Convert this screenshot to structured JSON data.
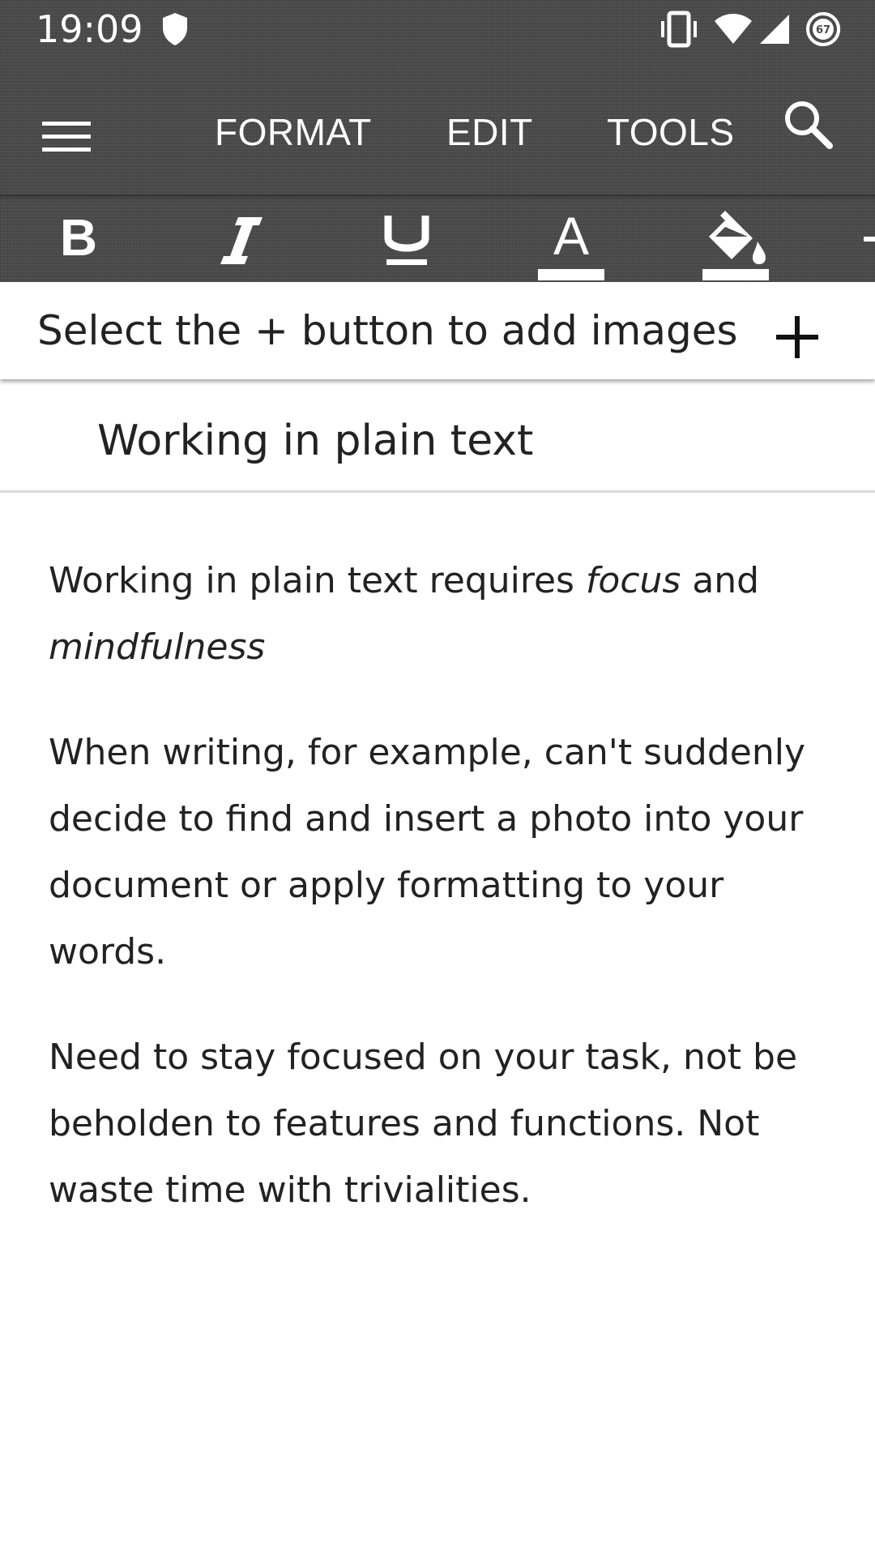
{
  "status_bar": {
    "time": "19:09",
    "icons": [
      "shield-icon",
      "vibrate-icon",
      "wifi-icon",
      "cell-signal-icon",
      "battery-icon"
    ],
    "battery_level": "67"
  },
  "app_bar": {
    "menu_icon": "hamburger-menu-icon",
    "tabs": [
      {
        "label": "FORMAT"
      },
      {
        "label": "EDIT"
      },
      {
        "label": "TOOLS"
      }
    ],
    "search_icon": "search-icon"
  },
  "format_toolbar": {
    "buttons": [
      {
        "name": "bold",
        "glyph": "B"
      },
      {
        "name": "italic",
        "glyph": "I"
      },
      {
        "name": "underline",
        "glyph": "U"
      },
      {
        "name": "text-color",
        "glyph": "A"
      },
      {
        "name": "fill-color",
        "glyph": ""
      }
    ]
  },
  "image_hint": {
    "text": "Select the + button to add images",
    "add_icon": "plus-icon"
  },
  "document": {
    "title": "Working in plain text",
    "paragraphs": [
      {
        "part1": "Working in plain text requires ",
        "italic1": "focus",
        "part2": " and ",
        "italic2": "mindfulness"
      },
      {
        "text": "When writing, for example, can't suddenly decide to find and insert a photo into your document or apply formatting to your words."
      },
      {
        "text": "Need to stay focused on your task, not be beholden to features and functions. Not waste time with trivialities."
      }
    ]
  },
  "colors": {
    "toolbar": "#4a4a4a",
    "text": "#222222",
    "background": "#ffffff",
    "divider": "#dadada"
  }
}
